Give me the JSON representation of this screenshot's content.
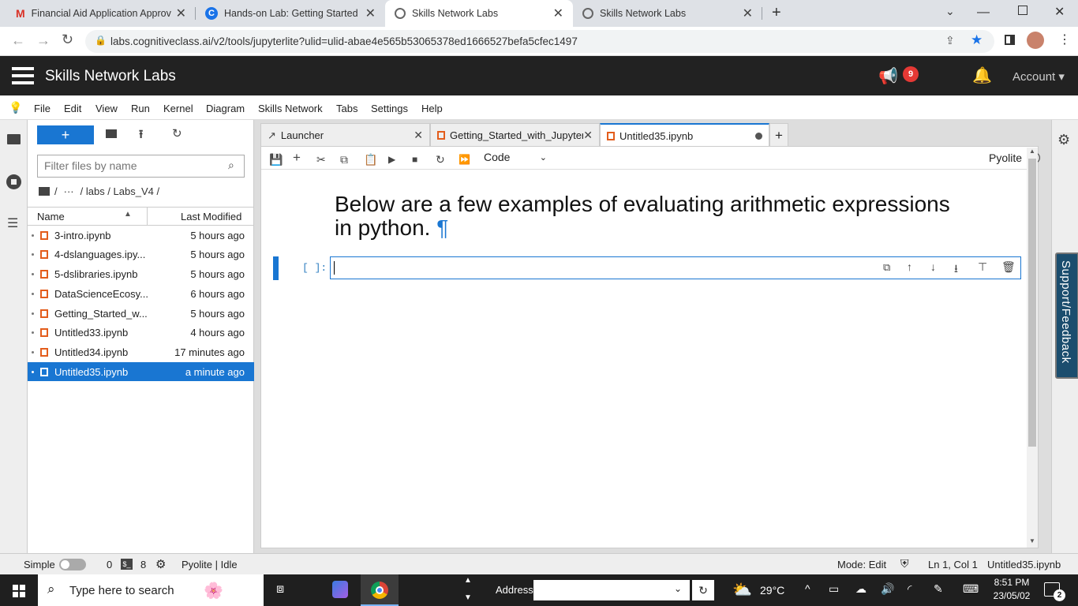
{
  "browser": {
    "tabs": [
      {
        "title": "Financial Aid Application Approv",
        "icon": "gmail-icon"
      },
      {
        "title": "Hands-on Lab: Getting Started w",
        "icon": "coursera-icon"
      },
      {
        "title": "Skills Network Labs",
        "icon": "globe-icon"
      },
      {
        "title": "Skills Network Labs",
        "icon": "globe-icon"
      }
    ],
    "url": "labs.cognitiveclass.ai/v2/tools/jupyterlite?ulid=ulid-abae4e565b53065378ed1666527befa5cfec1497"
  },
  "app": {
    "brand": "Skills Network Labs",
    "notif_count": "9",
    "account": "Account"
  },
  "menu": [
    "File",
    "Edit",
    "View",
    "Run",
    "Kernel",
    "Diagram",
    "Skills Network",
    "Tabs",
    "Settings",
    "Help"
  ],
  "filebrowser": {
    "new_label": "+",
    "filter_placeholder": "Filter files by name",
    "breadcrumb": {
      "sep": "/",
      "ellipsis": "···",
      "path": "/ labs / Labs_V4 /"
    },
    "col_name": "Name",
    "col_modified": "Last Modified",
    "files": [
      {
        "name": "3-intro.ipynb",
        "modified": "5 hours ago"
      },
      {
        "name": "4-dslanguages.ipy...",
        "modified": "5 hours ago"
      },
      {
        "name": "5-dslibraries.ipynb",
        "modified": "5 hours ago"
      },
      {
        "name": "DataScienceEcosy...",
        "modified": "6 hours ago"
      },
      {
        "name": "Getting_Started_w...",
        "modified": "5 hours ago"
      },
      {
        "name": "Untitled33.ipynb",
        "modified": "4 hours ago"
      },
      {
        "name": "Untitled34.ipynb",
        "modified": "17 minutes ago"
      },
      {
        "name": "Untitled35.ipynb",
        "modified": "a minute ago"
      }
    ]
  },
  "notebook": {
    "tabs": [
      {
        "title": "Launcher"
      },
      {
        "title": "Getting_Started_with_Jupyter"
      },
      {
        "title": "Untitled35.ipynb"
      }
    ],
    "cell_type": "Code",
    "kernel": "Pyolite",
    "heading_line1": "Below are a few examples of evaluating arithmetic expressions",
    "heading_line2": "in python.",
    "pilcrow": "¶",
    "prompt": "[ ]:"
  },
  "support_label": "Support/Feedback",
  "status": {
    "mode_label": "Simple",
    "count0": "0",
    "count8": "8",
    "kernel_status": "Pyolite | Idle",
    "mode": "Mode: Edit",
    "cursor": "Ln 1, Col 1",
    "file": "Untitled35.ipynb"
  },
  "taskbar": {
    "search": "Type here to search",
    "address_label": "Address",
    "temp": "29°C",
    "time": "8:51 PM",
    "date": "23/05/02",
    "notif": "2"
  }
}
